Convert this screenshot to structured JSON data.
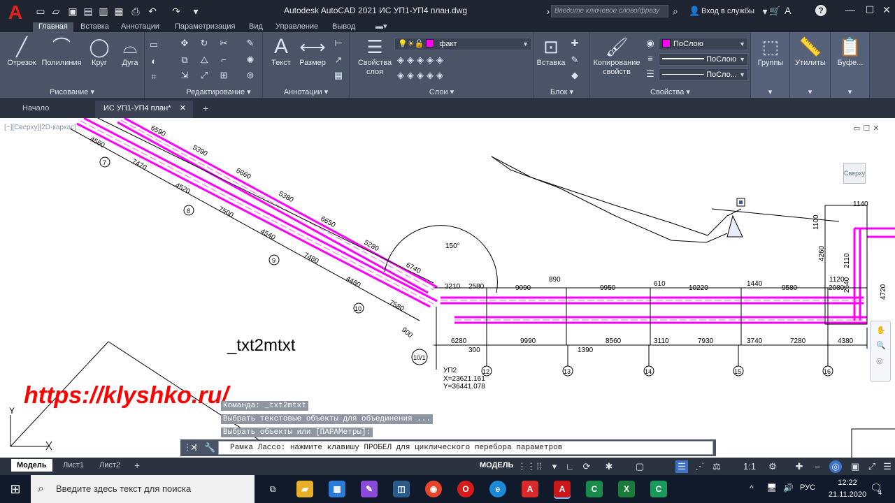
{
  "app": {
    "logo": "A",
    "title": "Autodesk AutoCAD 2021   ИС УП1-УП4 план.dwg",
    "search_placeholder": "Введите ключевое слово/фразу",
    "signin": "Вход в службы"
  },
  "ribbon_tabs": [
    "Главная",
    "Вставка",
    "Аннотации",
    "Параметризация",
    "Вид",
    "Управление",
    "Вывод"
  ],
  "ribbon": {
    "draw": {
      "title": "Рисование",
      "tools": [
        "Отрезок",
        "Полилиния",
        "Круг",
        "Дуга"
      ]
    },
    "modify": {
      "title": "Редактирование"
    },
    "annotation": {
      "title": "Аннотации",
      "tools": [
        "Текст",
        "Размер"
      ]
    },
    "layers": {
      "title": "Слои",
      "props_label": "Свойства\nслоя",
      "current_layer": "факт"
    },
    "block": {
      "title": "Блок",
      "insert_label": "Вставка"
    },
    "properties": {
      "title": "Свойства",
      "match_label": "Копирование\nсвойств",
      "color": "ПоСлою",
      "linetype": "ПоСлою",
      "lineweight": "ПоСло..."
    },
    "groups": {
      "label": "Группы"
    },
    "utilities": {
      "label": "Утилиты"
    },
    "clipboard": {
      "label": "Буфе..."
    }
  },
  "doc_tabs": [
    "Начало",
    "ИС УП1-УП4 план*"
  ],
  "viewport_label": "[−][Сверху][2D-каркас]",
  "viewcube_face": "Сверху",
  "drawing": {
    "dims_diagonal": [
      "6590",
      "5390",
      "4560",
      "7470",
      "6660",
      "4520",
      "5380",
      "7500",
      "6650",
      "4540",
      "5280",
      "7480",
      "6740",
      "4460",
      "7580",
      "900"
    ],
    "dims_top": [
      "3210",
      "2580",
      "890",
      "9090",
      "9950",
      "610",
      "10220",
      "1440",
      "9580",
      "2080",
      "1120"
    ],
    "dims_bottom": [
      "6280",
      "300",
      "9990",
      "1390",
      "8560",
      "3110",
      "7930",
      "3740",
      "7280",
      "4380"
    ],
    "dims_right": [
      "1140",
      "1100",
      "4260",
      "2110",
      "2640",
      "4720",
      "1130"
    ],
    "axis_marks": [
      "7",
      "8",
      "9",
      "10",
      "10/1",
      "12",
      "13",
      "14",
      "15",
      "16"
    ],
    "angle_label": "150°",
    "point_label": "УП2",
    "coord_x": "X=23621.161",
    "coord_y": "Y=36441.078"
  },
  "command_echo": "_txt2mtxt",
  "watermark": "https://klyshko.ru/",
  "command_history": [
    "Команда: _txt2mtxt",
    "Выбрать текстовые объекты для объединения ...",
    "Выбрать объекты или [ПАРАМетры]:"
  ],
  "command_prompt": "Рамка Лассо: нажмите клавишу ПРОБЕЛ для циклического перебора параметров",
  "layout_tabs": [
    "Модель",
    "Лист1",
    "Лист2"
  ],
  "status": {
    "model": "МОДЕЛЬ",
    "scale": "1:1"
  },
  "taskbar": {
    "search_placeholder": "Введите здесь текст для поиска",
    "lang": "РУС",
    "time": "12:22",
    "date": "21.11.2020",
    "notifications": "4"
  },
  "colors": {
    "accent_magenta": "#ff00ff",
    "titlebar": "#1e2430",
    "ribbon": "#4a5466",
    "watermark": "#ff0000"
  }
}
